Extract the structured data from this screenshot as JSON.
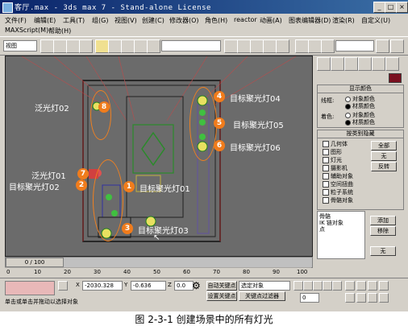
{
  "window": {
    "title": "客厅.max - 3ds max 7 - Stand-alone License",
    "minimize": "_",
    "maximize": "□",
    "close": "×"
  },
  "menu": {
    "row1": [
      "文件(F)",
      "编辑(E)",
      "工具(T)",
      "组(G)",
      "视图(V)",
      "创建(C)",
      "修改器(O)",
      "角色(H)",
      "reactor",
      "动画(A)",
      "图表编辑器(D)",
      "渲染(R)",
      "自定义(U)"
    ],
    "row2": [
      "MAXScript(M)",
      "帮助(H)"
    ]
  },
  "toolbar": {
    "selection_filter": "视图",
    "named_selection": ""
  },
  "viewport": {
    "lights": [
      {
        "num": "1",
        "label": "目标聚光灯01"
      },
      {
        "num": "2",
        "label": "目标聚光灯02"
      },
      {
        "num": "3",
        "label": "目标聚光灯03"
      },
      {
        "num": "4",
        "label": "目标聚光灯04"
      },
      {
        "num": "5",
        "label": "目标聚光灯05"
      },
      {
        "num": "6",
        "label": "目标聚光灯06"
      },
      {
        "num": "7",
        "label": "泛光灯01"
      },
      {
        "num": "8",
        "label": "泛光灯02"
      }
    ]
  },
  "panel": {
    "display_color": {
      "header": "显示颜色",
      "wireframe_label": "线框:",
      "shaded_label": "着色:",
      "opt_object": "对象颜色",
      "opt_material": "材质颜色"
    },
    "hide_by_category": {
      "header": "按类别隐藏",
      "items": [
        "几何体",
        "图形",
        "灯光",
        "摄影机",
        "辅助对象",
        "空间扭曲",
        "粒子系统",
        "骨骼对象"
      ],
      "btn_all": "全部",
      "btn_none": "无",
      "btn_invert": "反转"
    },
    "list": {
      "items": [
        "骨骼",
        "IK 链对象",
        "点"
      ],
      "btn_add": "添加",
      "btn_remove": "移除",
      "btn_none": "无"
    }
  },
  "timeline": {
    "frame": "0 / 100"
  },
  "ruler": {
    "ticks": [
      "0",
      "10",
      "20",
      "30",
      "40",
      "50",
      "60",
      "70",
      "80",
      "90",
      "100"
    ]
  },
  "status": {
    "prompt": "单击或单击并拖动以选择对象",
    "x_label": "X",
    "x_value": "-2030.328",
    "y_label": "Y",
    "y_value": "-0.636",
    "z_label": "Z",
    "z_value": "0.0",
    "autokey": "自动关键点",
    "selected_object": "选定对象",
    "set_key": "设置关键点",
    "key_filters": "关键点过滤器",
    "frame_input": "0"
  },
  "caption": "图 2-3-1    创建场景中的所有灯光",
  "colors": {
    "accent_orange": "#f07c1c",
    "viewport_bg": "#6b6b6b"
  }
}
